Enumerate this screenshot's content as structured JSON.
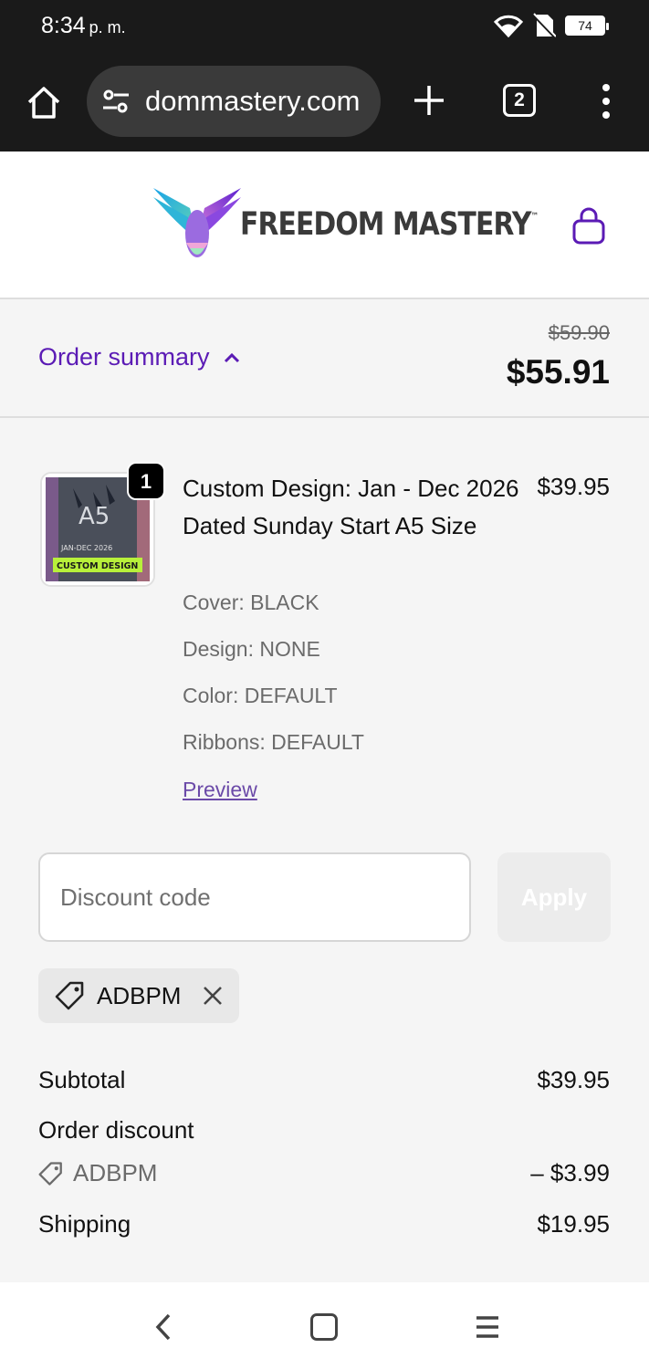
{
  "status_bar": {
    "time": "8:34",
    "ampm": "p. m.",
    "battery": "74"
  },
  "browser": {
    "url": "dommastery.com",
    "tab_count": "2"
  },
  "site": {
    "brand": "FREEDOM MASTERY",
    "trademark": "™"
  },
  "summary": {
    "label": "Order summary",
    "original_total": "$59.90",
    "total": "$55.91"
  },
  "line_item": {
    "quantity": "1",
    "thumbnail_text": {
      "size": "A5",
      "range": "JAN-DEC 2026",
      "tag": "CUSTOM DESIGN"
    },
    "title": "Custom Design: Jan - Dec 2026 Dated Sunday Start A5 Size",
    "price": "$39.95",
    "attributes": [
      "Cover: BLACK",
      "Design: NONE",
      "Color: DEFAULT",
      "Ribbons: DEFAULT"
    ],
    "preview_label": "Preview"
  },
  "discount": {
    "placeholder": "Discount code",
    "apply_label": "Apply",
    "applied_code": "ADBPM"
  },
  "totals": {
    "subtotal_label": "Subtotal",
    "subtotal_value": "$39.95",
    "order_discount_label": "Order discount",
    "order_discount_code": "ADBPM",
    "order_discount_value": "– $3.99",
    "shipping_label": "Shipping",
    "shipping_value": "$19.95"
  },
  "colors": {
    "accent": "#5b1bb5",
    "statusbar": "#1a1a1a"
  }
}
